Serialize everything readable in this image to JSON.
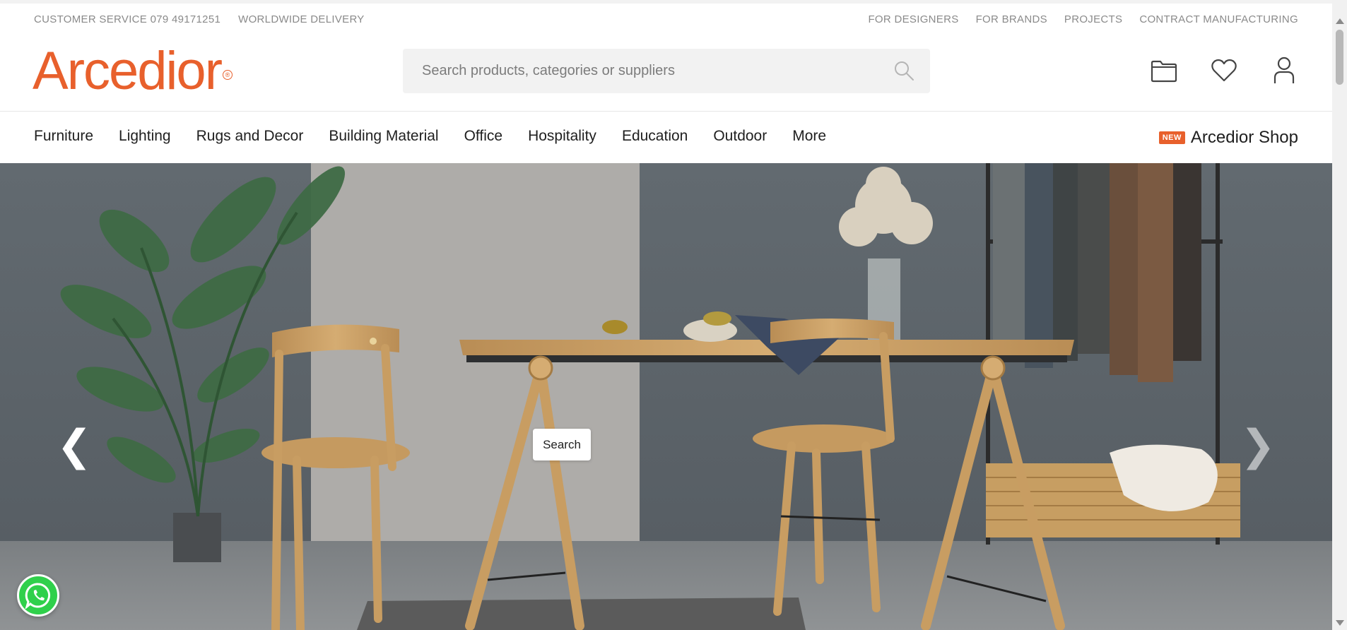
{
  "topbar": {
    "left": [
      "CUSTOMER SERVICE 079 49171251",
      "WORLDWIDE DELIVERY"
    ],
    "right": [
      "FOR DESIGNERS",
      "FOR BRANDS",
      "PROJECTS",
      "CONTRACT MANUFACTURING"
    ]
  },
  "header": {
    "logo_text": "Arcedior",
    "logo_mark": "®",
    "search_placeholder": "Search products, categories or suppliers",
    "icons": [
      "folder-icon",
      "heart-icon",
      "user-icon"
    ]
  },
  "nav": {
    "items": [
      "Furniture",
      "Lighting",
      "Rugs and Decor",
      "Building Material",
      "Office",
      "Hospitality",
      "Education",
      "Outdoor",
      "More"
    ],
    "shop_badge": "NEW",
    "shop_label": "Arcedior Shop"
  },
  "hero": {
    "prev_glyph": "❮",
    "next_glyph": "❯",
    "search_button": "Search"
  },
  "colors": {
    "brand": "#e8602c",
    "whatsapp": "#2fd04b"
  }
}
